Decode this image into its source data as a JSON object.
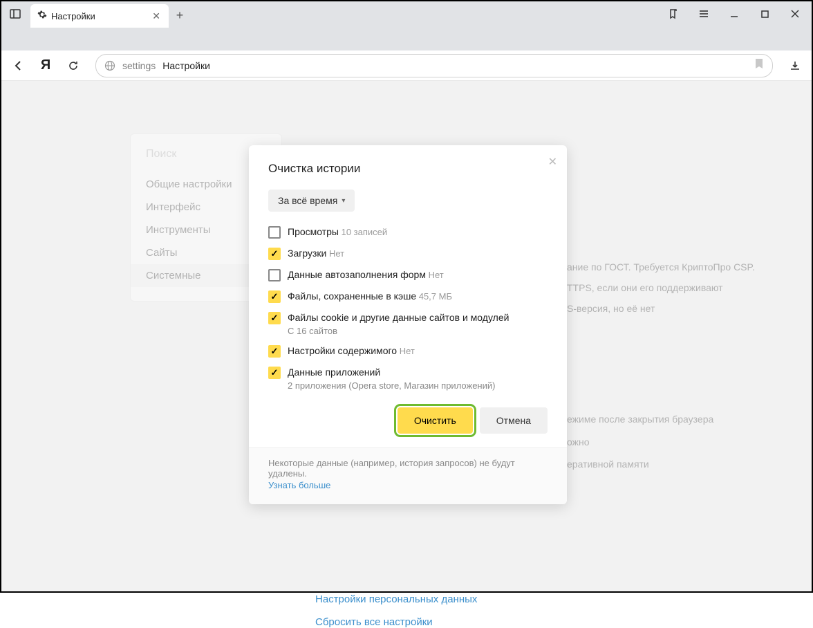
{
  "tab": {
    "title": "Настройки"
  },
  "address": {
    "prefix": "settings",
    "text": "Настройки"
  },
  "sidebar": {
    "search_placeholder": "Поиск",
    "items": [
      {
        "label": "Общие настройки"
      },
      {
        "label": "Интерфейс"
      },
      {
        "label": "Инструменты"
      },
      {
        "label": "Сайты"
      },
      {
        "label": "Системные"
      }
    ]
  },
  "background_lines": [
    "ание по ГОСТ. Требуется КриптоПро CSP.",
    "TTPS, если они его поддерживают",
    "S-версия, но её нет",
    "ежиме после закрытия браузера",
    "ожно",
    "еративной памяти"
  ],
  "bg_links": {
    "personal": "Настройки персональных данных",
    "reset": "Сбросить все настройки"
  },
  "modal": {
    "title": "Очистка истории",
    "time_select": "За всё время",
    "checks": [
      {
        "checked": false,
        "label": "Просмотры",
        "hint": "10 записей"
      },
      {
        "checked": true,
        "label": "Загрузки",
        "hint": "Нет"
      },
      {
        "checked": false,
        "label": "Данные автозаполнения форм",
        "hint": "Нет"
      },
      {
        "checked": true,
        "label": "Файлы, сохраненные в кэше",
        "hint": "45,7 МБ"
      },
      {
        "checked": true,
        "label": "Файлы cookie и другие данные сайтов и модулей",
        "sub": "С 16 сайтов"
      },
      {
        "checked": true,
        "label": "Настройки содержимого",
        "hint": "Нет"
      },
      {
        "checked": true,
        "label": "Данные приложений",
        "sub": "2 приложения (Opera store, Магазин приложений)"
      }
    ],
    "primary_btn": "Очистить",
    "secondary_btn": "Отмена",
    "footer_text": "Некоторые данные (например, история запросов) не будут удалены.",
    "footer_link": "Узнать больше"
  }
}
